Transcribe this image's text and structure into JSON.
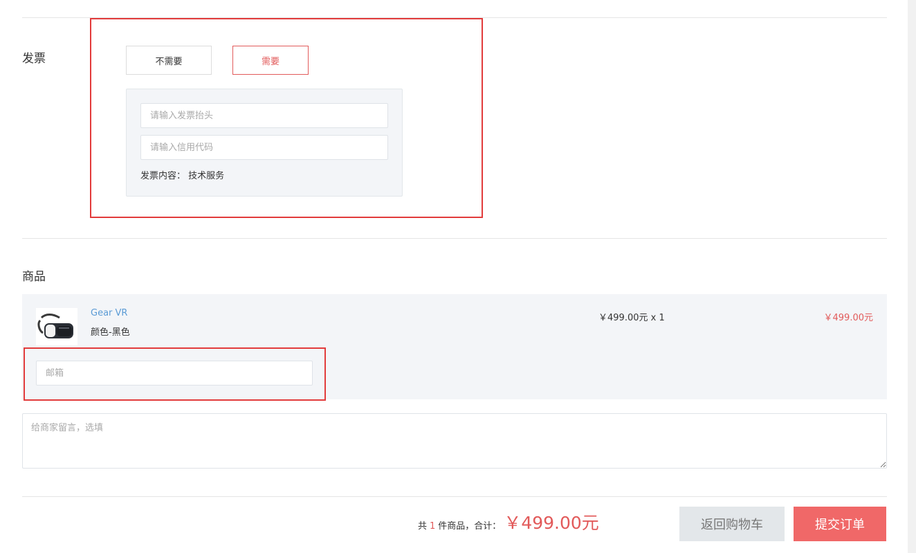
{
  "invoice": {
    "section_title": "发票",
    "option_no": "不需要",
    "option_yes": "需要",
    "selected": "需要",
    "title_placeholder": "请输入发票抬头",
    "credit_code_placeholder": "请输入信用代码",
    "content_label": "发票内容：",
    "content_value": "技术服务"
  },
  "goods": {
    "section_title": "商品",
    "item": {
      "name": "Gear VR",
      "spec": "颜色-黑色",
      "unit_price_qty": "￥499.00元 x 1",
      "subtotal": "￥499.00元",
      "image_icon": "vr-headset-image"
    },
    "email_placeholder": "邮箱"
  },
  "remark": {
    "placeholder": "给商家留言，选填"
  },
  "footer": {
    "prefix": "共",
    "count": "1",
    "suffix": "件商品，合计：",
    "total": "￥499.00元",
    "back_label": "返回购物车",
    "submit_label": "提交订单"
  },
  "colors": {
    "accent": "#e25a5a",
    "submit_bg": "#f06868",
    "back_bg": "#e3e7ea",
    "link": "#5b9bd5",
    "annotation": "#e23b3b",
    "panel_bg": "#f3f5f8"
  }
}
